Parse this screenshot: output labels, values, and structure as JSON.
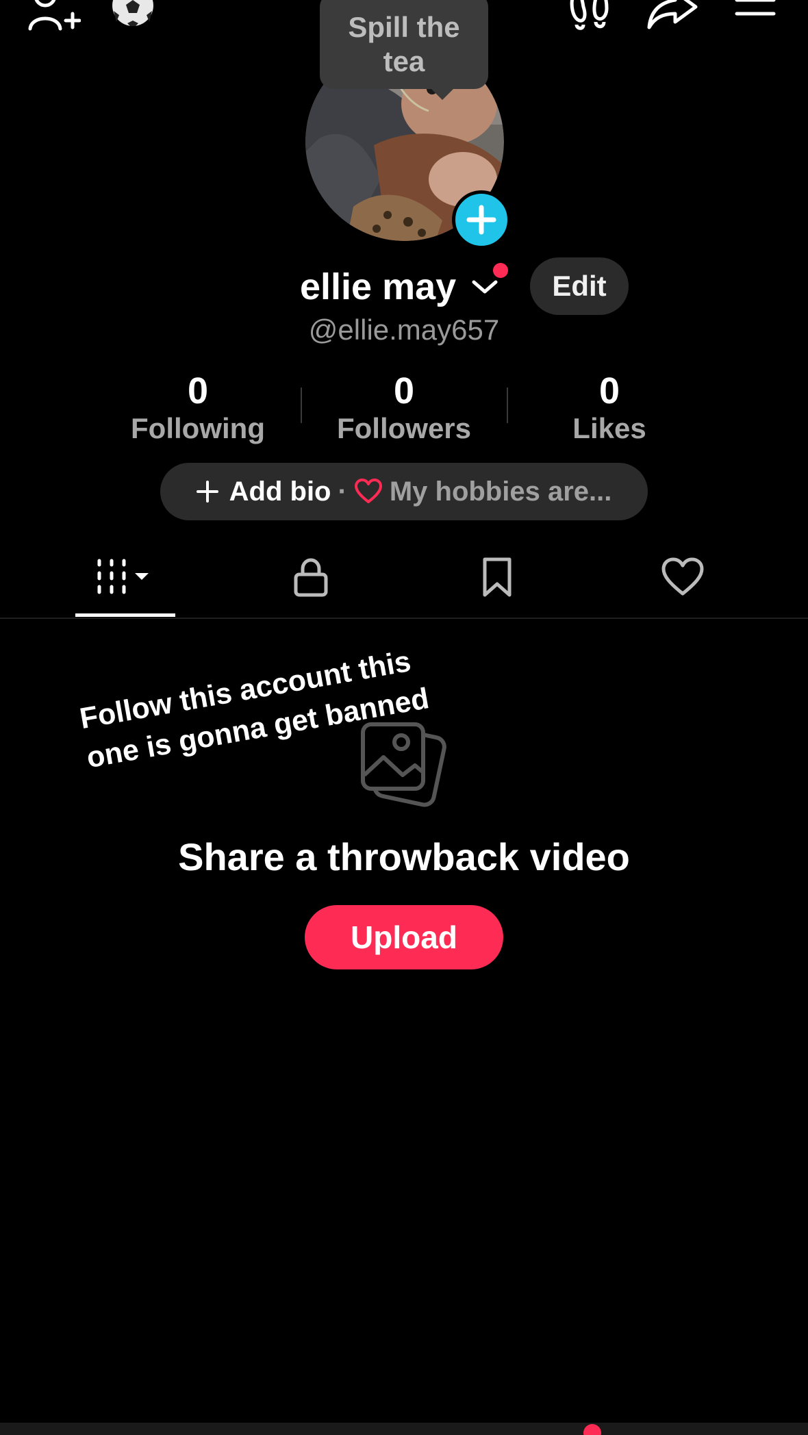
{
  "tooltip": {
    "text": "Spill the tea"
  },
  "profile": {
    "display_name": "ellie may",
    "username": "@ellie.may657",
    "edit_label": "Edit"
  },
  "stats": [
    {
      "value": "0",
      "label": "Following"
    },
    {
      "value": "0",
      "label": "Followers"
    },
    {
      "value": "0",
      "label": "Likes"
    }
  ],
  "bio": {
    "add_label": "Add bio",
    "separator": "·",
    "hobbies_text": "My hobbies are..."
  },
  "tabs": [
    {
      "icon": "videos-grid-icon",
      "active": true
    },
    {
      "icon": "lock-icon",
      "active": false
    },
    {
      "icon": "bookmark-icon",
      "active": false
    },
    {
      "icon": "heart-icon",
      "active": false
    }
  ],
  "overlay_text": "Follow this account this one is gonna get banned",
  "empty_state": {
    "title": "Share a throwback video",
    "upload_label": "Upload"
  },
  "top_bar": {
    "icons": [
      "add-friend-icon",
      "soccer-ball-icon",
      "footprints-icon",
      "share-icon",
      "menu-icon"
    ]
  },
  "colors": {
    "accent": "#fe2c55",
    "add_avatar": "#20c4e8",
    "background": "#000000",
    "pill": "#2b2b2b"
  }
}
